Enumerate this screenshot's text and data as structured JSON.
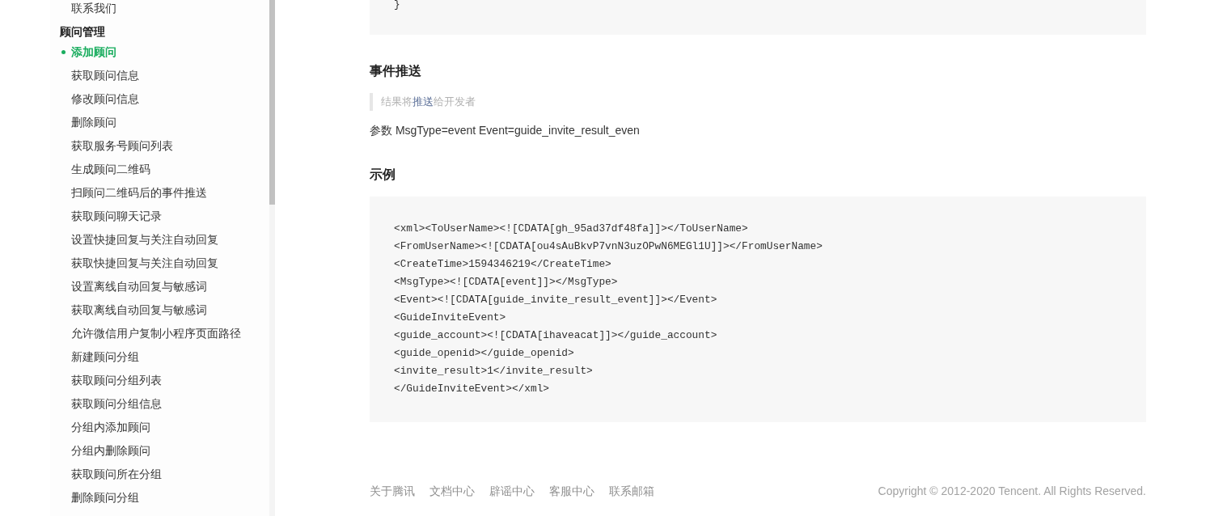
{
  "sidebar": {
    "sections": [
      {
        "items": [
          {
            "label": "联系我们",
            "selected": false
          }
        ]
      },
      {
        "title": "顾问管理",
        "items": [
          {
            "label": "添加顾问",
            "selected": true
          },
          {
            "label": "获取顾问信息",
            "selected": false
          },
          {
            "label": "修改顾问信息",
            "selected": false
          },
          {
            "label": "删除顾问",
            "selected": false
          },
          {
            "label": "获取服务号顾问列表",
            "selected": false
          },
          {
            "label": "生成顾问二维码",
            "selected": false
          },
          {
            "label": "扫顾问二维码后的事件推送",
            "selected": false
          },
          {
            "label": "获取顾问聊天记录",
            "selected": false
          },
          {
            "label": "设置快捷回复与关注自动回复",
            "selected": false
          },
          {
            "label": "获取快捷回复与关注自动回复",
            "selected": false
          },
          {
            "label": "设置离线自动回复与敏感词",
            "selected": false
          },
          {
            "label": "获取离线自动回复与敏感词",
            "selected": false
          },
          {
            "label": "允许微信用户复制小程序页面路径",
            "selected": false
          },
          {
            "label": "新建顾问分组",
            "selected": false
          },
          {
            "label": "获取顾问分组列表",
            "selected": false
          },
          {
            "label": "获取顾问分组信息",
            "selected": false
          },
          {
            "label": "分组内添加顾问",
            "selected": false
          },
          {
            "label": "分组内删除顾问",
            "selected": false
          },
          {
            "label": "获取顾问所在分组",
            "selected": false
          },
          {
            "label": "删除顾问分组",
            "selected": false
          }
        ]
      }
    ]
  },
  "content": {
    "blocks": [
      {
        "kind": "code",
        "lines": [
          "}"
        ]
      },
      {
        "kind": "heading",
        "text": "事件推送"
      },
      {
        "kind": "quote",
        "before": "结果将",
        "link": "推送",
        "after": "给开发者"
      },
      {
        "kind": "paragraph",
        "text": "参数 MsgType=event Event=guide_invite_result_even"
      },
      {
        "kind": "heading",
        "text": "示例"
      },
      {
        "kind": "code",
        "lines": [
          "<xml><ToUserName><![CDATA[gh_95ad37df48fa]]></ToUserName>",
          "<FromUserName><![CDATA[ou4sAuBkvP7vnN3uzOPwN6MEGl1U]]></FromUserName>",
          "<CreateTime>1594346219</CreateTime>",
          "<MsgType><![CDATA[event]]></MsgType>",
          "<Event><![CDATA[guide_invite_result_event]]></Event>",
          "<GuideInviteEvent>",
          "<guide_account><![CDATA[ihaveacat]]></guide_account>",
          "<guide_openid></guide_openid>",
          "<invite_result>1</invite_result>",
          "</GuideInviteEvent></xml>"
        ]
      }
    ]
  },
  "footer": {
    "links": [
      "关于腾讯",
      "文档中心",
      "辟谣中心",
      "客服中心",
      "联系邮箱"
    ],
    "copyright": "Copyright © 2012-2020 Tencent. All Rights Reserved."
  }
}
